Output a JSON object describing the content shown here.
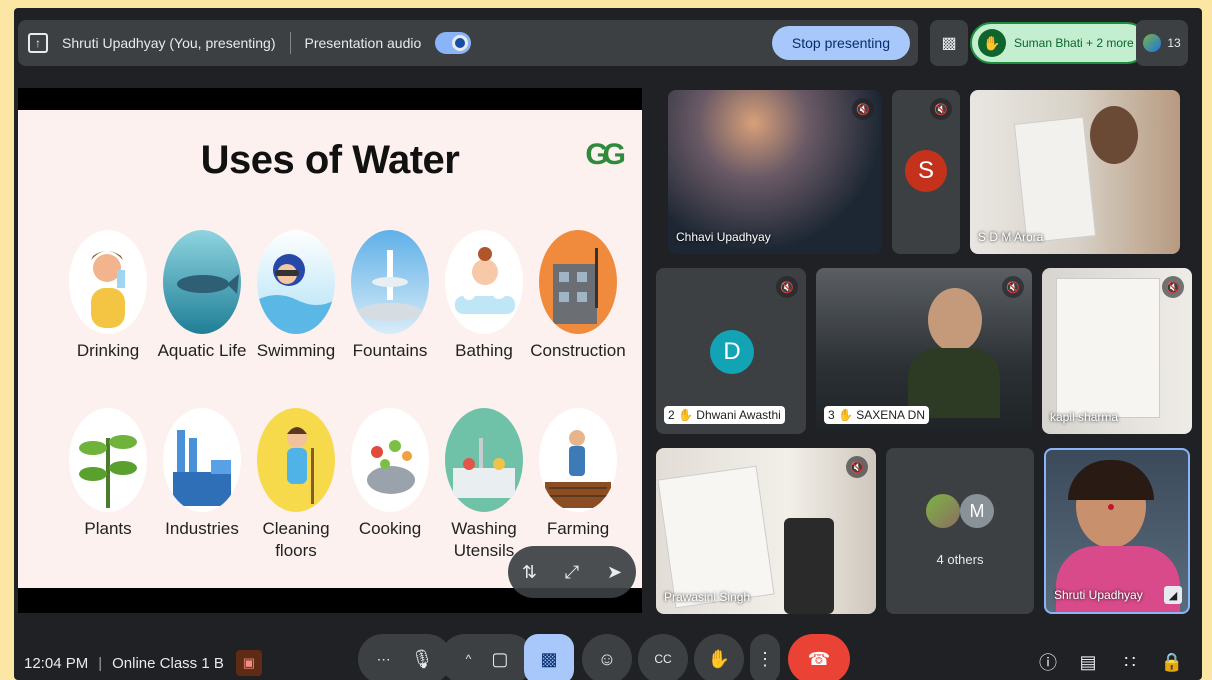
{
  "top_bar": {
    "presenter": "Shruti Upadhyay (You, presenting)",
    "audio_label": "Presentation audio",
    "stop_label": "Stop presenting",
    "raised_hands": "Suman Bhati + 2 more",
    "participant_count": "13"
  },
  "slide": {
    "title": "Uses of Water",
    "logo": "GG",
    "row1": [
      "Drinking",
      "Aquatic Life",
      "Swimming",
      "Fountains",
      "Bathing",
      "Construction"
    ],
    "row2": [
      "Plants",
      "Industries",
      "Cleaning floors",
      "Cooking",
      "Washing Utensils",
      "Farming"
    ]
  },
  "tiles": {
    "t1": "Chhavi Upadhyay",
    "t2_avatar": "S",
    "t3": "S D M Arora",
    "t4": "Dhwani Awasthi",
    "t4_num": "2",
    "t4_avatar": "D",
    "t5": "SAXENA DN",
    "t5_num": "3",
    "t6": "kapil sharma",
    "t7": "Prawasini Singh",
    "t8": "4 others",
    "t8_avatar": "M",
    "t9": "Shruti Upadhyay"
  },
  "bottom": {
    "time": "12:04 PM",
    "meeting": "Online Class 1 B"
  },
  "colors": {
    "accent": "#a8c7fa",
    "end_call": "#ea4335",
    "raise_hand": "#c4eed0"
  }
}
